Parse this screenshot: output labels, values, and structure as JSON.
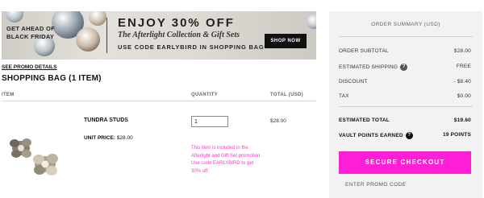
{
  "banner": {
    "left_text": "GET AHEAD OF BLACK FRIDAY",
    "headline": "ENJOY 30% OFF",
    "subhead": "The Afterlight Collection & Gift Sets",
    "code_line": "USE CODE EARLYBIRD IN SHOPPING BAG*",
    "cta": "SHOP NOW"
  },
  "cart": {
    "promo_link": "SEE PROMO DETAILS",
    "title": "SHOPPING BAG (1 ITEM)",
    "columns": {
      "item": "ITEM",
      "quantity": "QUANTITY",
      "total": "TOTAL (USD)"
    },
    "items": [
      {
        "name": "TUNDRA STUDS",
        "unit_price_label": "UNIT PRICE:",
        "unit_price": "$28.00",
        "quantity": "1",
        "total": "$28.00",
        "promo_note": "This item is included in the Afterlight and Gift Set promotion. Use code EARLYBIRD to get 30% off."
      }
    ]
  },
  "summary": {
    "title": "ORDER SUMMARY (USD)",
    "rows": [
      {
        "label": "ORDER SUBTOTAL",
        "value": "$28.00"
      },
      {
        "label": "ESTIMATED SHIPPING",
        "value": "FREE"
      },
      {
        "label": "DISCOUNT",
        "value": "- $8.40"
      },
      {
        "label": "TAX",
        "value": "$0.00"
      }
    ],
    "estimated_total": {
      "label": "ESTIMATED TOTAL",
      "value": "$19.60"
    },
    "vault_points": {
      "label": "VAULT POINTS EARNED",
      "value": "19 POINTS"
    },
    "help_icon": "?",
    "checkout_label": "SECURE CHECKOUT",
    "enter_promo": "ENTER PROMO CODE"
  },
  "colors": {
    "accent": "#ff1fd7",
    "promo_text": "#ff33cc",
    "panel_bg": "#f2f2f2"
  },
  "icons": [
    "question-icon",
    "earring-product-image",
    "jewel-decor"
  ]
}
